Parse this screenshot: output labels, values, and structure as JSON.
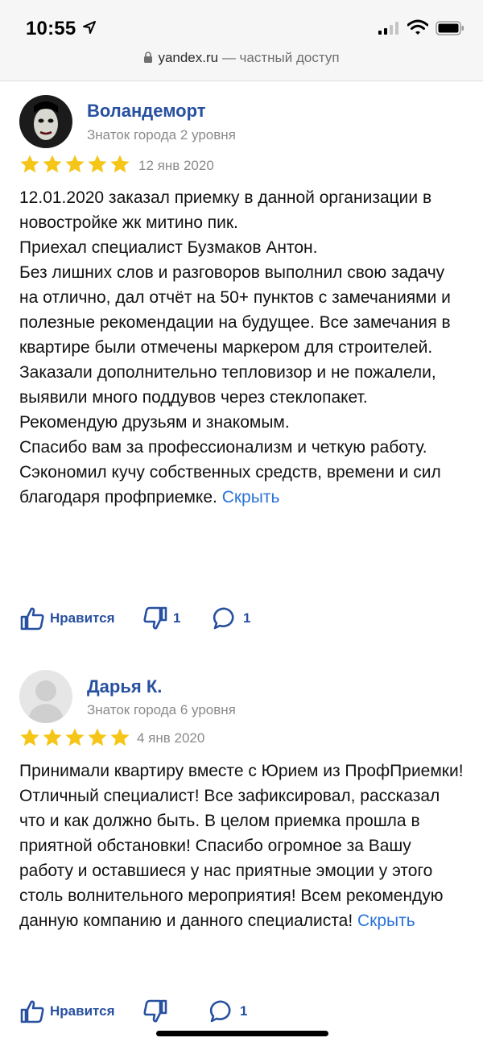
{
  "status_bar": {
    "time": "10:55",
    "location_icon": "navigation-arrow-icon",
    "signal_icon": "cellular-signal-icon",
    "wifi_icon": "wifi-icon",
    "battery_icon": "battery-icon"
  },
  "browser": {
    "lock_icon": "lock-icon",
    "host": "yandex.ru",
    "suffix": " — частный доступ"
  },
  "reviews": [
    {
      "author": "Воландеморт",
      "level": "Знаток города 2 уровня",
      "rating": 5,
      "date": "12 янв 2020",
      "text": "12.01.2020 заказал приемку в данной организации в новостройке жк митино пик.\nПриехал специалист Бузмаков Антон.\nБез лишних слов и разговоров выполнил свою задачу на отлично, дал отчёт на 50+ пунктов с замечаниями и полезные рекомендации на будущее. Все замечания в квартире были отмечены маркером для строителей.\nЗаказали дополнительно тепловизор и не пожалели, выявили много поддувов через стеклопакет.\nРекомендую друзьям и знакомым.\nСпасибо вам за профессионализм и четкую работу.\nСэкономил кучу собственных средств, времени и сил благодаря профприемке.",
      "hide_label": "Скрыть",
      "like_label": "Нравится",
      "dislike_count": "1",
      "comment_count": "1"
    },
    {
      "author": "Дарья К.",
      "level": "Знаток города 6 уровня",
      "rating": 5,
      "date": "4 янв 2020",
      "text": "Принимали квартиру вместе с Юрием из ПрофПриемки! Отличный специалист! Все зафиксировал, рассказал что и как должно быть. В целом приемка прошла в приятной обстановки! Спасибо огромное за Вашу работу и оставшиеся у нас приятные эмоции у этого столь волнительного мероприятия! Всем рекомендую данную компанию и данного специалиста!",
      "hide_label": "Скрыть",
      "like_label": "Нравится",
      "comment_count": "1"
    }
  ],
  "colors": {
    "author": "#2750a0",
    "link": "#2a73d6",
    "star": "#f5c518",
    "muted": "#8a8a8a"
  }
}
